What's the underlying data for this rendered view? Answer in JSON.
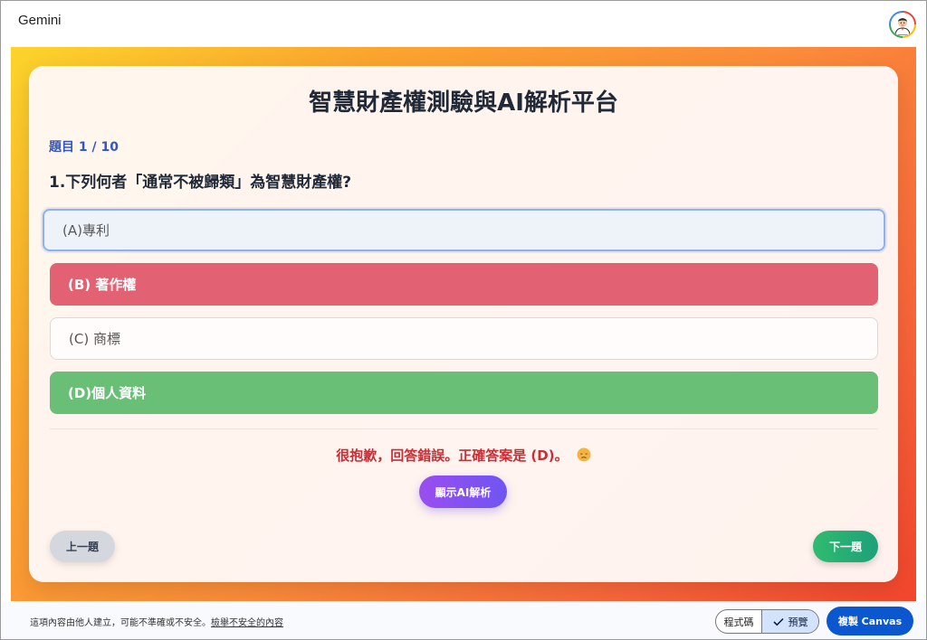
{
  "app": {
    "title": "Gemini"
  },
  "quiz": {
    "title": "智慧財產權測驗與AI解析平台",
    "progress": "題目 1 / 10",
    "question": "1.下列何者「通常不被歸類」為智慧財產權?",
    "options": [
      {
        "label": "(A)專利",
        "state": "focused"
      },
      {
        "label": "(B) 著作權",
        "state": "wrong"
      },
      {
        "label": "(C) 商標",
        "state": "default"
      },
      {
        "label": "(D)個人資料",
        "state": "correct"
      }
    ],
    "feedback": "很抱歉，回答錯誤。正確答案是 (D)。",
    "feedback_icon": "disappointed-face-icon",
    "ai_button_label": "顯示AI解析",
    "prev_label": "上一題",
    "next_label": "下一題"
  },
  "footer": {
    "disclaimer": "這項內容由他人建立，可能不準確或不安全。",
    "report_link": "檢舉不安全的內容",
    "toggle_code_label": "程式碼",
    "toggle_preview_label": "預覽",
    "copy_button_label": "複製 Canvas"
  },
  "colors": {
    "wrong": "#e26273",
    "correct": "#68bf75",
    "focus_border": "#8fb1ef",
    "ai_button": "#7f52f1",
    "next_button": "#22aa74",
    "copy_button": "#0b57d0",
    "progress_text": "#3056c8",
    "feedback_text": "#c82e36"
  }
}
